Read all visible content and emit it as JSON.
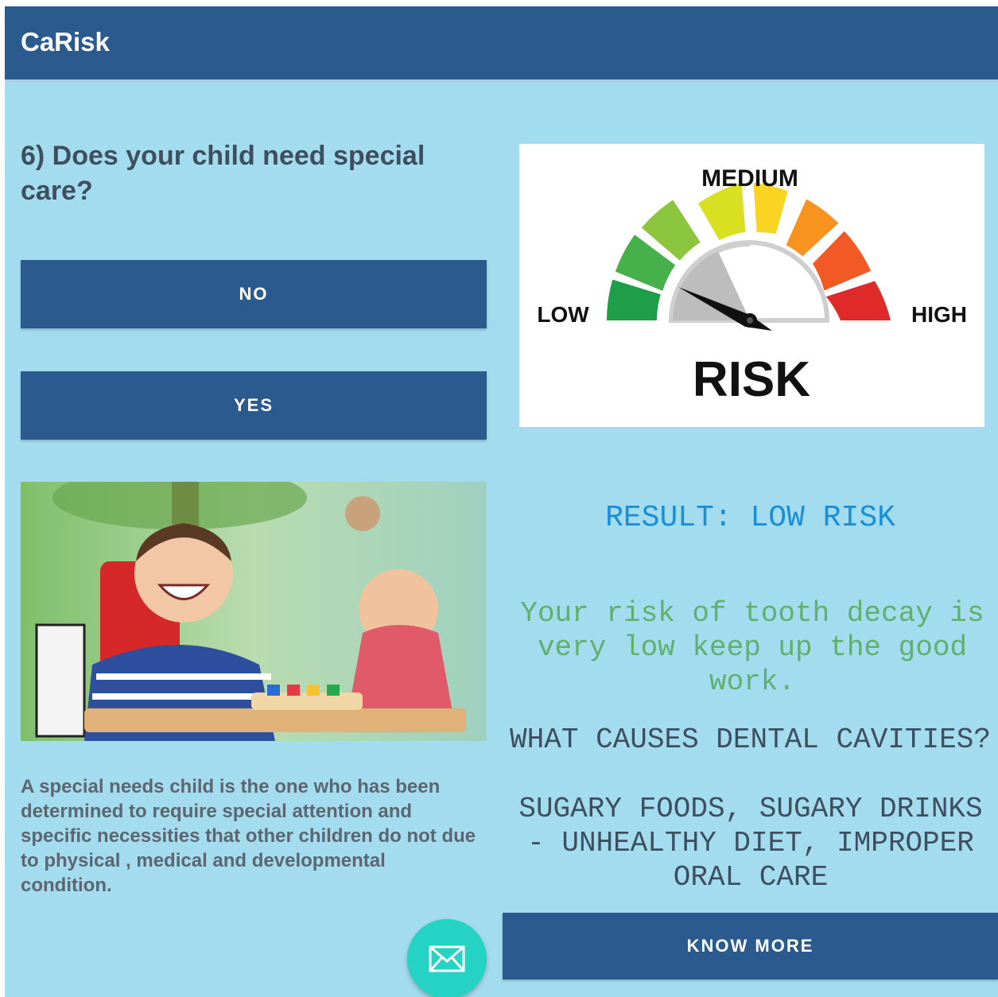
{
  "appbar": {
    "title": "CaRisk"
  },
  "question": {
    "text": "6) Does your child need special care?",
    "options": [
      "NO",
      "YES"
    ]
  },
  "description": "A special needs child is the one who has been determined to require special attention and specific necessities that other children do not due to physical , medical and developmental condition.",
  "meter": {
    "low": "LOW",
    "medium": "MEDIUM",
    "high": "HIGH",
    "risk": "RISK"
  },
  "result": {
    "heading": "RESULT: LOW RISK",
    "message": "Your risk of tooth decay is very low keep up the good work.",
    "causes_question": "WHAT CAUSES DENTAL CAVITIES?",
    "causes_answer": "SUGARY FOODS, SUGARY DRINKS - UNHEALTHY DIET, IMPROPER ORAL CARE"
  },
  "know_more_label": "KNOW MORE",
  "fab_icon": "mail-icon",
  "colors": {
    "appbar": "#2b5a8e",
    "background": "#a4dcef",
    "fab": "#25d3c4",
    "result": "#1a8fd6",
    "message": "#5fb06d"
  }
}
